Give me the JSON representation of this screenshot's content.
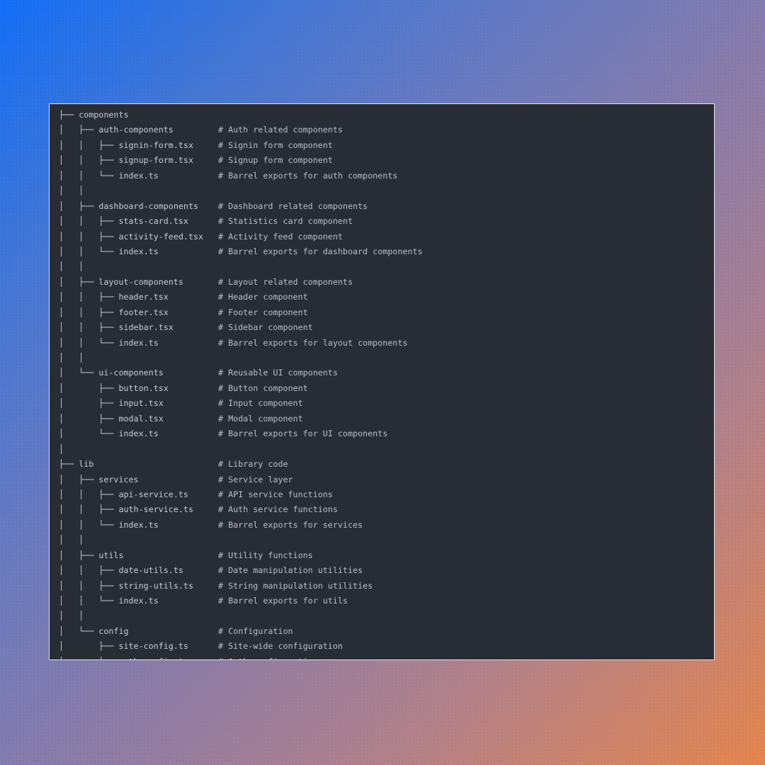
{
  "code_view": {
    "lines": [
      {
        "tree": "├── components",
        "comment": ""
      },
      {
        "tree": "│   ├── auth-components",
        "comment": "# Auth related components"
      },
      {
        "tree": "│   │   ├── signin-form.tsx",
        "comment": "# Signin form component"
      },
      {
        "tree": "│   │   ├── signup-form.tsx",
        "comment": "# Signup form component"
      },
      {
        "tree": "│   │   └── index.ts",
        "comment": "# Barrel exports for auth components"
      },
      {
        "tree": "│   │",
        "comment": ""
      },
      {
        "tree": "│   ├── dashboard-components",
        "comment": "# Dashboard related components"
      },
      {
        "tree": "│   │   ├── stats-card.tsx",
        "comment": "# Statistics card component"
      },
      {
        "tree": "│   │   ├── activity-feed.tsx",
        "comment": "# Activity feed component"
      },
      {
        "tree": "│   │   └── index.ts",
        "comment": "# Barrel exports for dashboard components"
      },
      {
        "tree": "│   │",
        "comment": ""
      },
      {
        "tree": "│   ├── layout-components",
        "comment": "# Layout related components"
      },
      {
        "tree": "│   │   ├── header.tsx",
        "comment": "# Header component"
      },
      {
        "tree": "│   │   ├── footer.tsx",
        "comment": "# Footer component"
      },
      {
        "tree": "│   │   ├── sidebar.tsx",
        "comment": "# Sidebar component"
      },
      {
        "tree": "│   │   └── index.ts",
        "comment": "# Barrel exports for layout components"
      },
      {
        "tree": "│   │",
        "comment": ""
      },
      {
        "tree": "│   └── ui-components",
        "comment": "# Reusable UI components"
      },
      {
        "tree": "│       ├── button.tsx",
        "comment": "# Button component"
      },
      {
        "tree": "│       ├── input.tsx",
        "comment": "# Input component"
      },
      {
        "tree": "│       ├── modal.tsx",
        "comment": "# Modal component"
      },
      {
        "tree": "│       └── index.ts",
        "comment": "# Barrel exports for UI components"
      },
      {
        "tree": "│",
        "comment": ""
      },
      {
        "tree": "├── lib",
        "comment": "# Library code"
      },
      {
        "tree": "│   ├── services",
        "comment": "# Service layer"
      },
      {
        "tree": "│   │   ├── api-service.ts",
        "comment": "# API service functions"
      },
      {
        "tree": "│   │   ├── auth-service.ts",
        "comment": "# Auth service functions"
      },
      {
        "tree": "│   │   └── index.ts",
        "comment": "# Barrel exports for services"
      },
      {
        "tree": "│   │",
        "comment": ""
      },
      {
        "tree": "│   ├── utils",
        "comment": "# Utility functions"
      },
      {
        "tree": "│   │   ├── date-utils.ts",
        "comment": "# Date manipulation utilities"
      },
      {
        "tree": "│   │   ├── string-utils.ts",
        "comment": "# String manipulation utilities"
      },
      {
        "tree": "│   │   └── index.ts",
        "comment": "# Barrel exports for utils"
      },
      {
        "tree": "│   │",
        "comment": ""
      },
      {
        "tree": "│   └── config",
        "comment": "# Configuration"
      },
      {
        "tree": "│       ├── site-config.ts",
        "comment": "# Site-wide configuration"
      },
      {
        "tree": "│       └── auth-config.ts",
        "comment": "# Auth configuration"
      }
    ]
  },
  "colors": {
    "panel_background": "#282c34",
    "panel_border": "#e6e6ea",
    "text": "#c7ccd6"
  }
}
